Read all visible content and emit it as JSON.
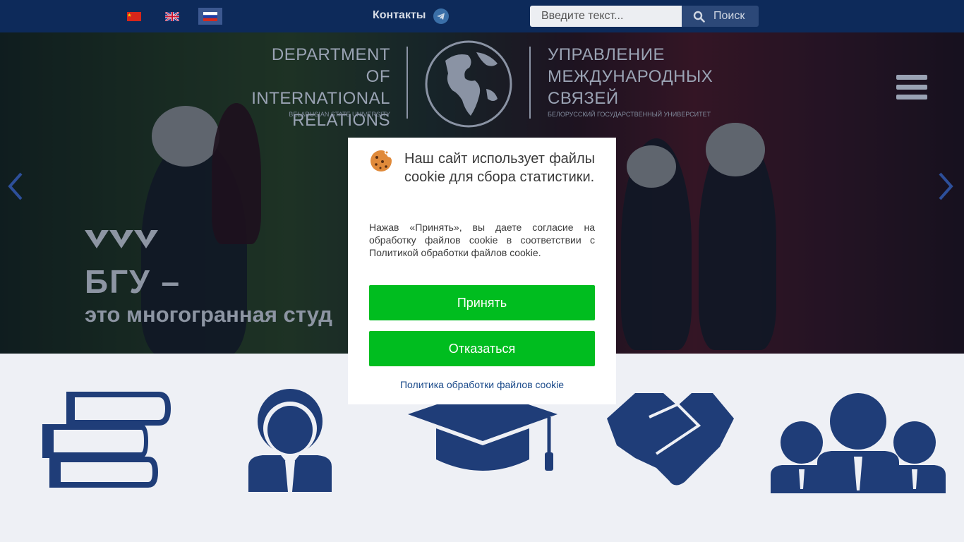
{
  "header": {
    "languages": [
      {
        "code": "zh",
        "label": "中文",
        "flag_color": "#d7261a",
        "active": false
      },
      {
        "code": "en",
        "label": "English",
        "flag_color": "#1f3a8a",
        "active": false
      },
      {
        "code": "ru",
        "label": "Русский",
        "flag_color": "#ffffff",
        "active": true
      }
    ],
    "contacts_label": "Контакты",
    "search": {
      "placeholder": "Введите текст...",
      "button_label": "Поиск"
    }
  },
  "logo": {
    "en_lines": [
      "DEPARTMENT",
      "OF INTERNATIONAL",
      "RELATIONS"
    ],
    "en_sub": "BELARUSIAN STATE UNIVERSITY",
    "ru_lines": [
      "УПРАВЛЕНИЕ",
      "МЕЖДУНАРОДНЫХ",
      "СВЯЗЕЙ"
    ],
    "ru_sub": "БЕЛОРУССКИЙ ГОСУДАРСТВЕННЫЙ УНИВЕРСИТЕТ"
  },
  "hero": {
    "title": "БГУ –",
    "subtitle": "это многогранная студ"
  },
  "cookie_modal": {
    "title": "Наш сайт использует файлы cookie для сбора статистики.",
    "text": "Нажав «Принять», вы даете согласие на обработку файлов cookie в соответствии с Политикой обработки файлов cookie.",
    "accept_label": "Принять",
    "decline_label": "Отказаться",
    "policy_link": "Политика обработки файлов cookie"
  },
  "colors": {
    "topbar": "#0d2a5a",
    "accent_green": "#00bd1f",
    "icon_blue": "#1f3d78",
    "link_blue": "#1a4a8a"
  },
  "feature_icons": [
    "books-icon",
    "person-icon",
    "graduation-cap-icon",
    "handshake-icon",
    "group-icon"
  ]
}
